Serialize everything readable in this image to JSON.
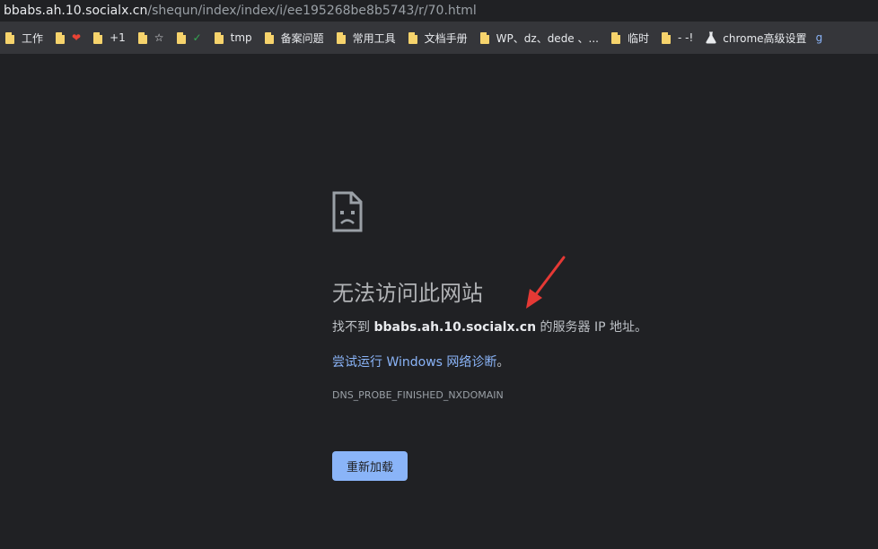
{
  "address_bar": {
    "host": "bbabs.ah.10.socialx.cn",
    "path": "/shequn/index/index/i/ee195268be8b5743/r/70.html"
  },
  "bookmarks": [
    {
      "label": "工作",
      "icon": "folder-icon"
    },
    {
      "label": "❤",
      "icon": "folder-icon",
      "color": "#ea4335"
    },
    {
      "label": "+1",
      "icon": "folder-icon"
    },
    {
      "label": "☆",
      "icon": "folder-icon"
    },
    {
      "label": "✓",
      "icon": "folder-icon",
      "color": "#34a853"
    },
    {
      "label": "tmp",
      "icon": "folder-icon"
    },
    {
      "label": "备案问题",
      "icon": "folder-icon"
    },
    {
      "label": "常用工具",
      "icon": "folder-icon"
    },
    {
      "label": "文档手册",
      "icon": "folder-icon"
    },
    {
      "label": "WP、dz、dede 、...",
      "icon": "folder-icon"
    },
    {
      "label": "临时",
      "icon": "folder-icon"
    },
    {
      "label": "- -!",
      "icon": "folder-icon"
    },
    {
      "label": "chrome高级设置",
      "icon": "flask-icon"
    }
  ],
  "bookmark_overflow": "g",
  "error_page": {
    "title": "无法访问此网站",
    "desc_prefix": "找不到 ",
    "desc_host": "bbabs.ah.10.socialx.cn",
    "desc_suffix": " 的服务器 IP 地址。",
    "suggest_link": "尝试运行 Windows 网络诊断",
    "suggest_suffix": "。",
    "error_code": "DNS_PROBE_FINISHED_NXDOMAIN",
    "reload_label": "重新加载",
    "icon": "sad-page-icon"
  },
  "colors": {
    "background": "#202124",
    "bookmarks_bar": "#35363a",
    "folder": "#f6d36c",
    "link": "#8ab4f8",
    "button": "#8ab4f8",
    "annotation_arrow": "#e53935"
  }
}
